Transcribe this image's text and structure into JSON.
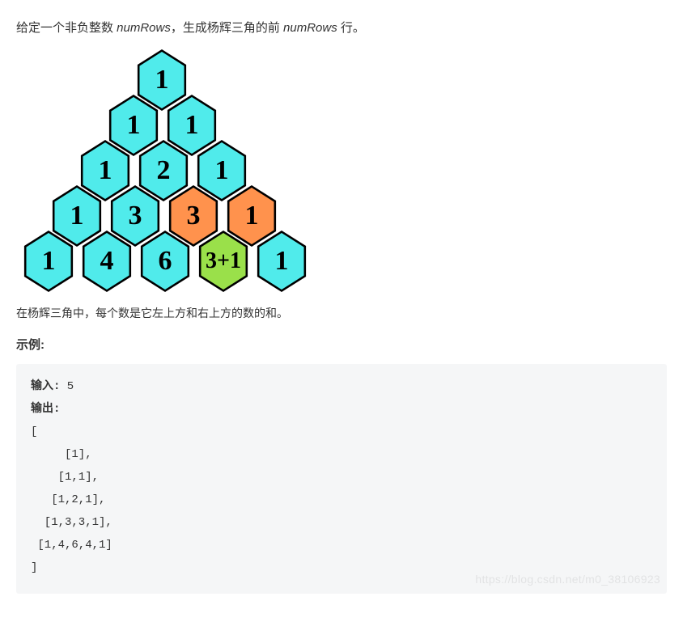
{
  "desc_pre": "给定一个非负整数 ",
  "desc_var": "numRows",
  "desc_mid": "，生成杨辉三角的前 ",
  "desc_post": " 行。",
  "triangle": [
    {
      "indent": 140,
      "cells": [
        {
          "v": "1",
          "c": "cyan"
        }
      ]
    },
    {
      "indent": 105,
      "cells": [
        {
          "v": "1",
          "c": "cyan"
        },
        {
          "v": "1",
          "c": "cyan"
        }
      ]
    },
    {
      "indent": 70,
      "cells": [
        {
          "v": "1",
          "c": "cyan"
        },
        {
          "v": "2",
          "c": "cyan"
        },
        {
          "v": "1",
          "c": "cyan"
        }
      ]
    },
    {
      "indent": 35,
      "cells": [
        {
          "v": "1",
          "c": "cyan"
        },
        {
          "v": "3",
          "c": "cyan"
        },
        {
          "v": "3",
          "c": "orange"
        },
        {
          "v": "1",
          "c": "orange"
        }
      ]
    },
    {
      "indent": 0,
      "cells": [
        {
          "v": "1",
          "c": "cyan"
        },
        {
          "v": "4",
          "c": "cyan"
        },
        {
          "v": "6",
          "c": "cyan"
        },
        {
          "v": "3+1",
          "c": "green",
          "sum": true
        },
        {
          "v": "1",
          "c": "cyan"
        }
      ]
    }
  ],
  "note": "在杨辉三角中，每个数是它左上方和右上方的数的和。",
  "example_heading": "示例:",
  "code": {
    "input_label": "输入:",
    "input_value": " 5",
    "output_label": "输出:",
    "lines": [
      "[",
      "     [1],",
      "    [1,1],",
      "   [1,2,1],",
      "  [1,3,3,1],",
      " [1,4,6,4,1]",
      "]"
    ]
  },
  "watermark": "https://blog.csdn.net/m0_38106923"
}
